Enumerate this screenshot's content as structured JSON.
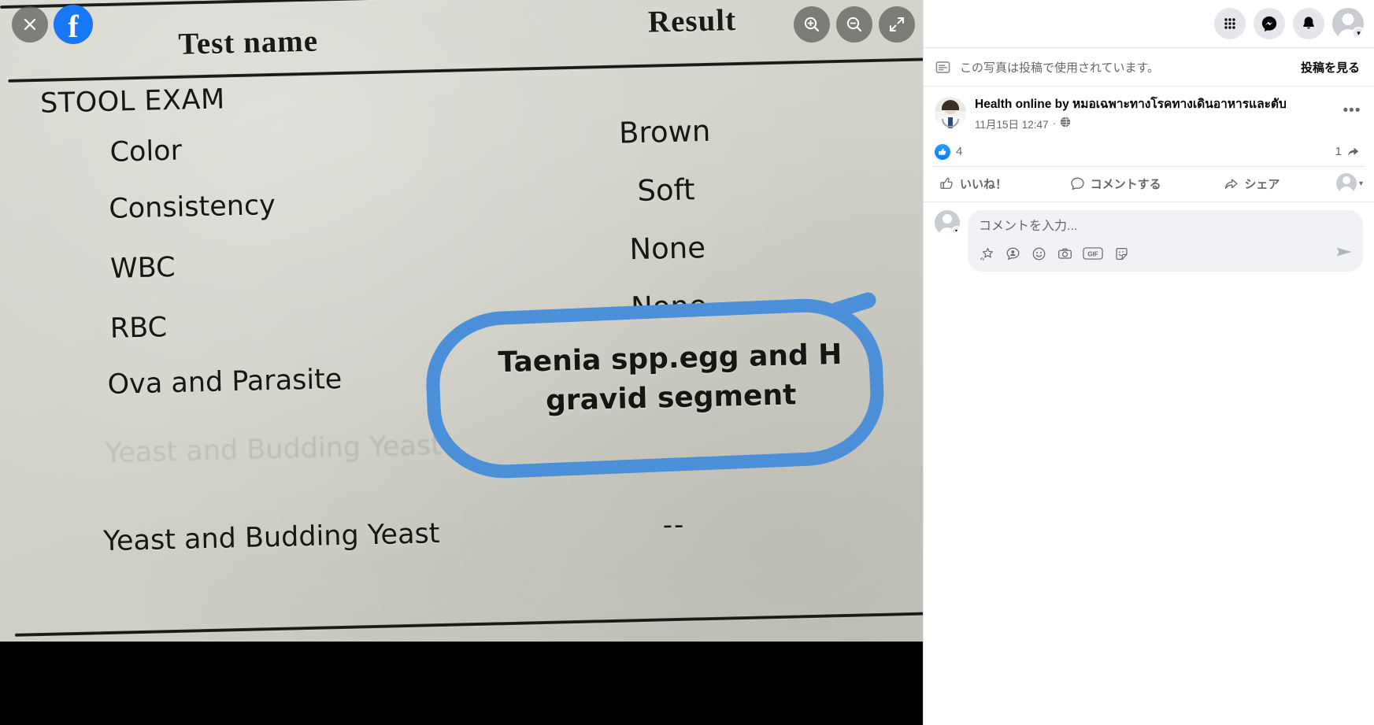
{
  "viewer": {
    "close_label": "×",
    "brand": "f",
    "controls": [
      {
        "name": "zoom-in-icon"
      },
      {
        "name": "zoom-out-icon"
      },
      {
        "name": "expand-icon"
      }
    ]
  },
  "photo_document": {
    "columns": {
      "test_name": "Test name",
      "result": "Result"
    },
    "section": "STOOL EXAM",
    "rows": [
      {
        "test": "Color",
        "result": "Brown"
      },
      {
        "test": "Consistency",
        "result": "Soft"
      },
      {
        "test": "WBC",
        "result": "None"
      },
      {
        "test": "RBC",
        "result": "None"
      },
      {
        "test": "Ova and Parasite",
        "result": "Taenia spp.egg and H gravid segment"
      },
      {
        "test": "Yeast and Budding Yeast",
        "result": "--"
      }
    ],
    "ghost_text": "Yeast and Budding Yeast",
    "highlight_color": "#4a90d9",
    "paper_color": "#d4d4cb"
  },
  "sidebar": {
    "topbar": {
      "menu_icon": "grid-apps-icon",
      "messenger_icon": "messenger-icon",
      "notifications_icon": "bell-icon",
      "account_icon": "account-avatar-icon"
    },
    "used_notice": {
      "icon": "post-note-icon",
      "text": "この写真は投稿で使用されています。",
      "link": "投稿を見る"
    },
    "post": {
      "author": "Health online by หมอเฉพาะทางโรคทางเดินอาหารและตับ",
      "timestamp": "11月15日 12:47",
      "privacy_icon": "globe-icon",
      "more_icon": "ellipsis-icon"
    },
    "stats": {
      "reaction_icon": "like-thumb-icon",
      "reaction_count": "4",
      "share_count": "1",
      "share_icon": "share-arrow-icon"
    },
    "actions": [
      {
        "icon": "thumbs-up-icon",
        "label": "いいね！"
      },
      {
        "icon": "comment-bubble-icon",
        "label": "コメントする"
      },
      {
        "icon": "share-icon",
        "label": "シェア"
      }
    ],
    "composer": {
      "placeholder": "コメントを入力...",
      "tools": [
        {
          "name": "sticker-star-icon"
        },
        {
          "name": "avatar-icon"
        },
        {
          "name": "emoji-icon"
        },
        {
          "name": "camera-icon"
        },
        {
          "name": "gif-icon"
        },
        {
          "name": "sticker-icon"
        }
      ],
      "send_icon": "send-icon",
      "gif_label": "GIF"
    }
  }
}
